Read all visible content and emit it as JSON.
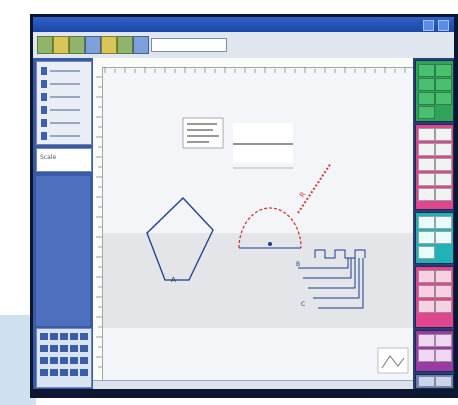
{
  "app": {
    "title": ""
  },
  "left_panel": {
    "field_label": "Scale"
  },
  "canvas": {
    "annotations": [
      {
        "text": "A"
      },
      {
        "text": "R"
      },
      {
        "text": "B"
      },
      {
        "text": "C"
      }
    ]
  },
  "status": {
    "text": ""
  },
  "colors": {
    "frame": "#1c3f8e",
    "panel_green": "#2fa35a",
    "panel_pink": "#e0468e",
    "panel_teal": "#1fb3b5",
    "panel_purple": "#9a3aa3",
    "dimension_red": "#d23a3a"
  }
}
